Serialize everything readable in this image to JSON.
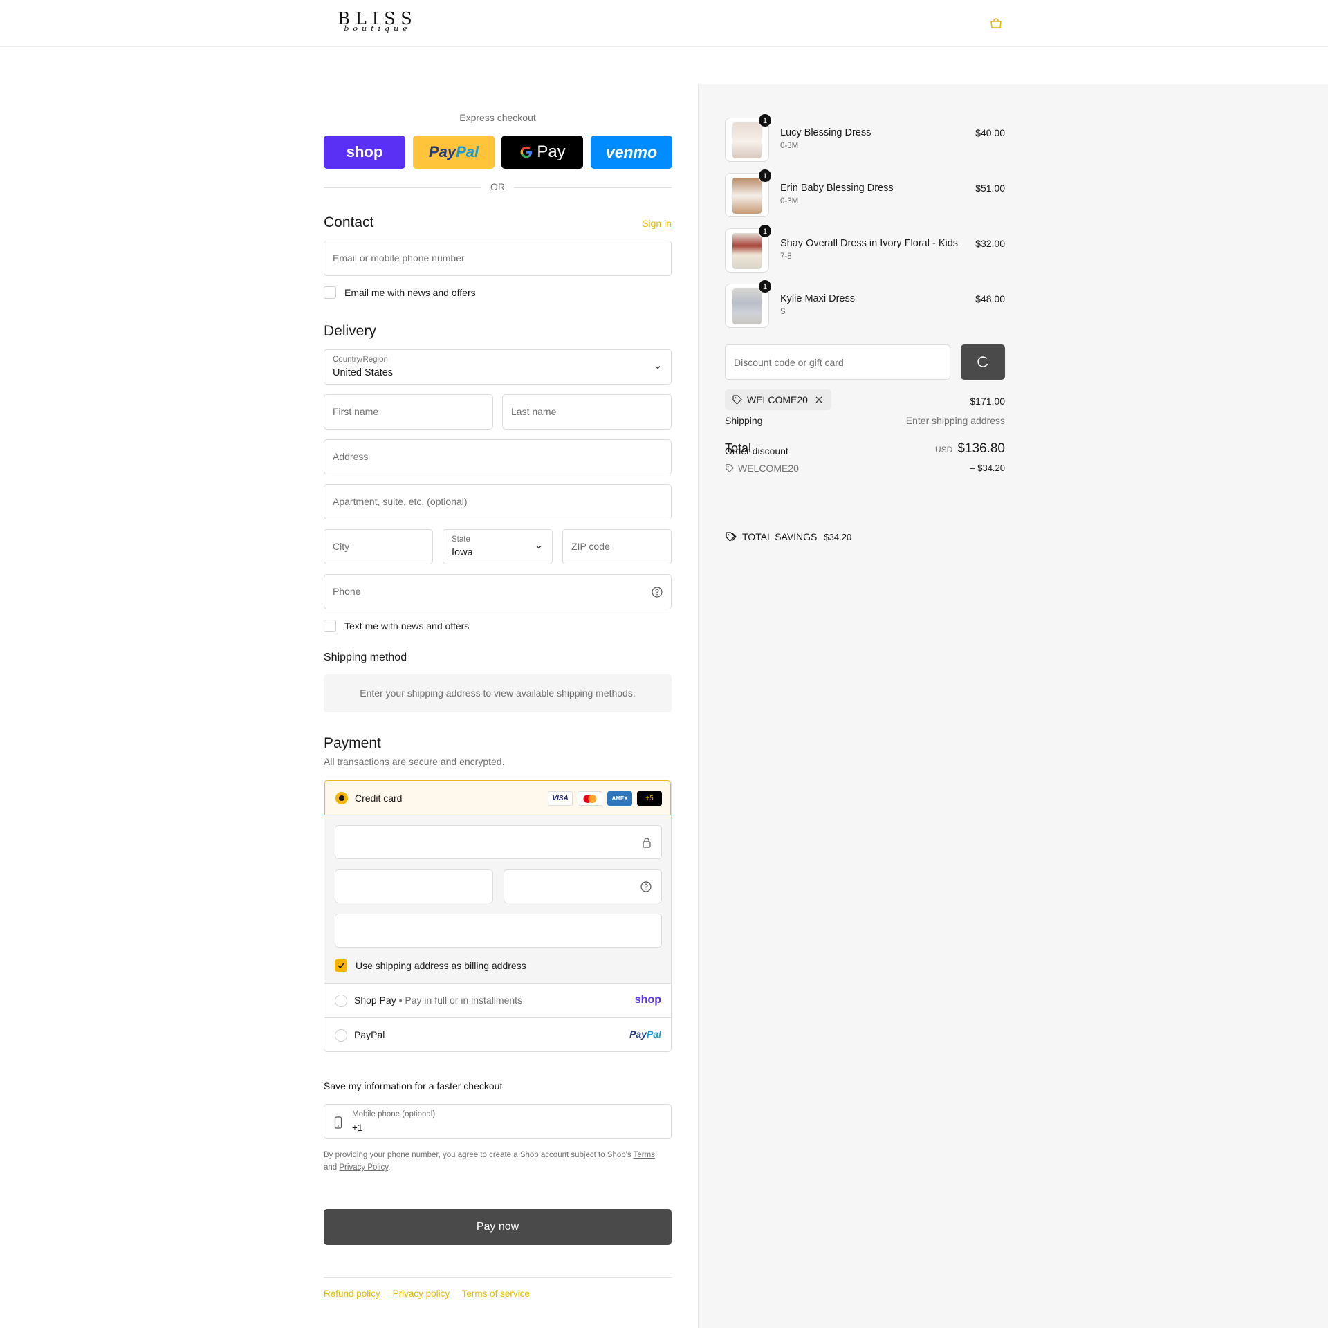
{
  "header": {
    "logo_main": "BLISS",
    "logo_sub": "boutique",
    "cart_icon": "shopping-bag-icon"
  },
  "colors": {
    "accent": "#f5b400",
    "link": "#e6b800",
    "shop_pay": "#5a31f4",
    "paypal": "#ffc439",
    "venmo": "#008cff",
    "dark_button": "#4a4a4a"
  },
  "express": {
    "title": "Express checkout",
    "shop_label": "shop",
    "paypal_left": "Pay",
    "paypal_right": "Pal",
    "gpay_label": "Pay",
    "venmo_label": "venmo",
    "or_label": "OR"
  },
  "contact": {
    "title": "Contact",
    "sign_in": "Sign in",
    "email_placeholder": "Email or mobile phone number",
    "news_label": "Email me with news and offers"
  },
  "delivery": {
    "title": "Delivery",
    "country_label": "Country/Region",
    "country_value": "United States",
    "first_name": "First name",
    "last_name": "Last name",
    "address": "Address",
    "apartment": "Apartment, suite, etc. (optional)",
    "city": "City",
    "state_label": "State",
    "state_value": "Iowa",
    "zip": "ZIP code",
    "phone": "Phone",
    "text_label": "Text me with news and offers"
  },
  "shipping_method": {
    "title": "Shipping method",
    "note": "Enter your shipping address to view available shipping methods."
  },
  "payment": {
    "title": "Payment",
    "subtitle": "All transactions are secure and encrypted.",
    "credit_card": "Credit card",
    "cards": [
      "VISA",
      "",
      "AMEX",
      "+5"
    ],
    "billing_label": "Use shipping address as billing address",
    "shop_pay_label": "Shop Pay",
    "shop_pay_sub": "Pay in full or in installments",
    "shop_pay_logo": "shop",
    "paypal_label": "PayPal",
    "paypal_logo_left": "Pay",
    "paypal_logo_right": "Pal"
  },
  "save": {
    "title": "Save my information for a faster checkout",
    "mobile_label": "Mobile phone (optional)",
    "mobile_value": "+1",
    "legal_prefix": "By providing your phone number, you agree to create a Shop account subject to Shop's",
    "terms": "Terms",
    "and": "and",
    "privacy": "Privacy Policy"
  },
  "pay_now": "Pay now",
  "footer": {
    "refund": "Refund policy",
    "privacy": "Privacy policy",
    "terms": "Terms of service"
  },
  "cart": {
    "items": [
      {
        "name": "Lucy Blessing Dress",
        "variant": "0-3M",
        "price": "$40.00",
        "qty": "1"
      },
      {
        "name": "Erin Baby Blessing Dress",
        "variant": "0-3M",
        "price": "$51.00",
        "qty": "1"
      },
      {
        "name": "Shay Overall Dress in Ivory Floral - Kids",
        "variant": "7-8",
        "price": "$32.00",
        "qty": "1"
      },
      {
        "name": "Kylie Maxi Dress",
        "variant": "S",
        "price": "$48.00",
        "qty": "1"
      }
    ],
    "discount_placeholder": "Discount code or gift card",
    "applied_code": "WELCOME20",
    "subtotal_value": "$171.00",
    "shipping_label": "Shipping",
    "shipping_value": "Enter shipping address",
    "total_label": "Total",
    "order_discount_label": "Order discount",
    "currency": "USD",
    "total_value": "$136.80",
    "discount_code": "WELCOME20",
    "discount_value": "– $34.20",
    "savings_label": "TOTAL SAVINGS",
    "savings_value": "$34.20"
  }
}
